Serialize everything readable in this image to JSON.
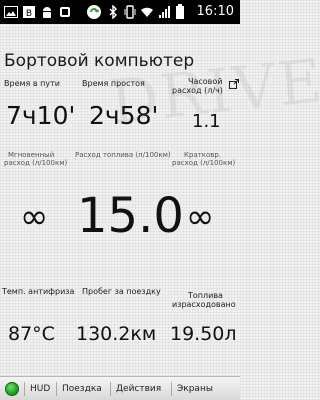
{
  "status_bar": {
    "time": "16:10",
    "icons": [
      "image-icon",
      "bb-icon",
      "android-icon",
      "droid-icon",
      "bluetooth-icon",
      "vibrate-icon",
      "wifi-icon",
      "signal-icon",
      "battery-icon"
    ]
  },
  "header": {
    "title": "Бортовой компьютер"
  },
  "row1": {
    "trip_time": {
      "label_line1": "Время в пути",
      "label_line2": "",
      "value": "7ч10'"
    },
    "idle_time": {
      "label_line1": "Время простоя",
      "label_line2": "",
      "value": "2ч58'"
    },
    "hourly_consumption": {
      "label_line1": "Часовой",
      "label_line2": "расход (л/ч)",
      "value": "1.1"
    }
  },
  "row2": {
    "instant_consumption": {
      "label_line1": "Мгновенный",
      "label_line2": "расход (л/100км)",
      "value": "∞"
    },
    "fuel_consumption": {
      "label_line1": "Расход топлива (л/100км)",
      "label_line2": "",
      "value": "15.0"
    },
    "short_term_consumption": {
      "label_line1": "Кратковр.",
      "label_line2": "расход (л/100км)",
      "value": "∞"
    }
  },
  "row3": {
    "antifreeze_temp": {
      "label_line1": "Темп. антифриза",
      "label_line2": "",
      "value": "87°C"
    },
    "trip_distance": {
      "label_line1": "Пробег за поездку",
      "label_line2": "",
      "value": "130.2км"
    },
    "fuel_used": {
      "label_line1": "Топлива",
      "label_line2": "израсходовано",
      "value": "19.50л"
    }
  },
  "tabs": {
    "hud": "HUD",
    "trip": "Поездка",
    "actions": "Действия",
    "screens": "Экраны"
  },
  "colors": {
    "status_bar_bg": "#000000",
    "background": "#f1f1f1",
    "connection_indicator": "#1fa21f"
  }
}
